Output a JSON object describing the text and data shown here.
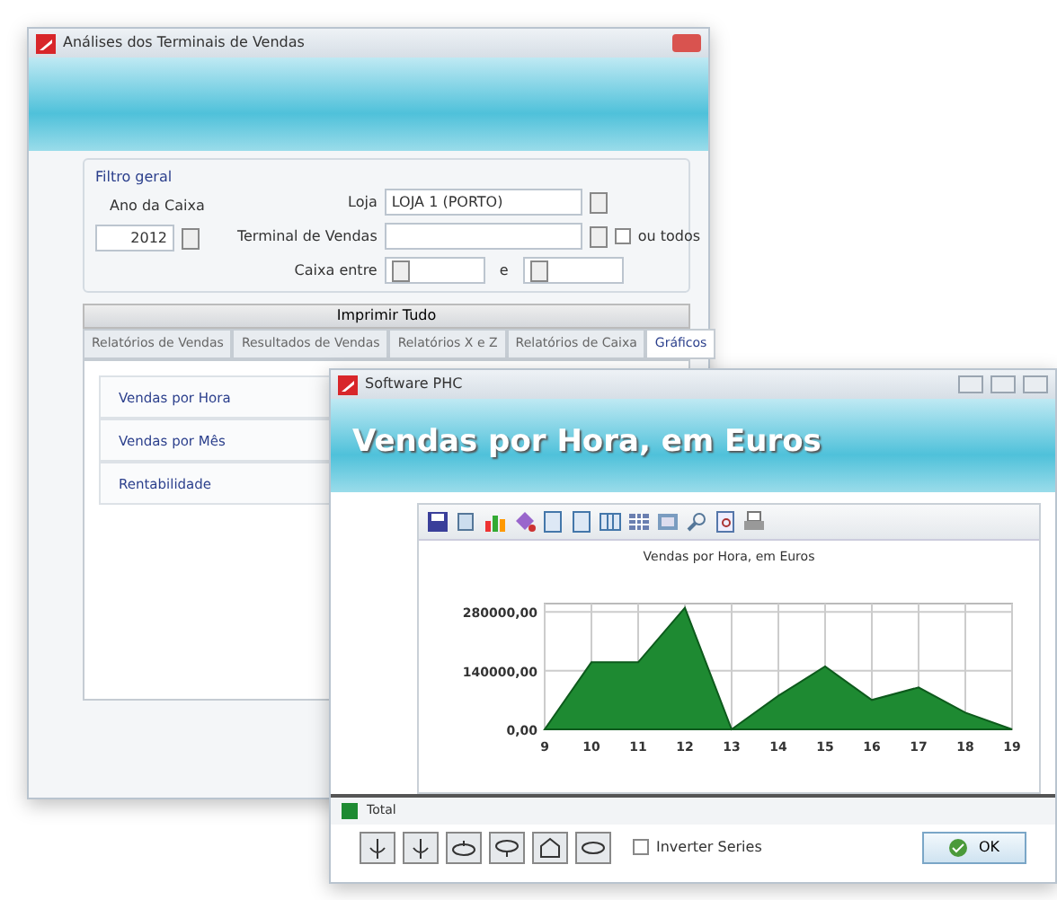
{
  "main_window": {
    "title": "Análises dos Terminais de Vendas",
    "filter": {
      "legend": "Filtro geral",
      "year_label": "Ano da Caixa",
      "year_value": "2012",
      "store_label": "Loja",
      "store_value": "LOJA 1 (PORTO)",
      "terminal_label": "Terminal de Vendas",
      "all_label": "ou todos",
      "all_checked": false,
      "range_label": "Caixa entre",
      "range_sep": "e"
    },
    "print_all": "Imprimir Tudo",
    "tabs": [
      {
        "label": "Relatórios de Vendas",
        "selected": false
      },
      {
        "label": "Resultados de Vendas",
        "selected": false
      },
      {
        "label": "Relatórios X e Z",
        "selected": false
      },
      {
        "label": "Relatórios de Caixa",
        "selected": false
      },
      {
        "label": "Gráficos",
        "selected": true
      }
    ],
    "reports": [
      "Vendas por Hora",
      "Vendas por Mês",
      "Rentabilidade"
    ]
  },
  "chart_window": {
    "title": "Software PHC",
    "banner": "Vendas por Hora, em Euros",
    "chart_data": {
      "type": "area",
      "title": "Vendas por Hora, em Euros",
      "categories": [
        "9",
        "10",
        "11",
        "12",
        "13",
        "14",
        "15",
        "16",
        "17",
        "18",
        "19"
      ],
      "series": [
        {
          "name": "Total",
          "color": "#1e8a32",
          "values": [
            0,
            160000,
            160000,
            290000,
            0,
            80000,
            150000,
            70000,
            100000,
            40000,
            0
          ]
        }
      ],
      "ylim": [
        0,
        300000
      ],
      "grid": true,
      "yticks": [
        {
          "value": 0,
          "label": "0,00"
        },
        {
          "value": 140000,
          "label": "140000,00"
        },
        {
          "value": 280000,
          "label": "280000,00"
        }
      ]
    },
    "invert_label": "Inverter Series",
    "invert_checked": false,
    "ok": "OK"
  }
}
